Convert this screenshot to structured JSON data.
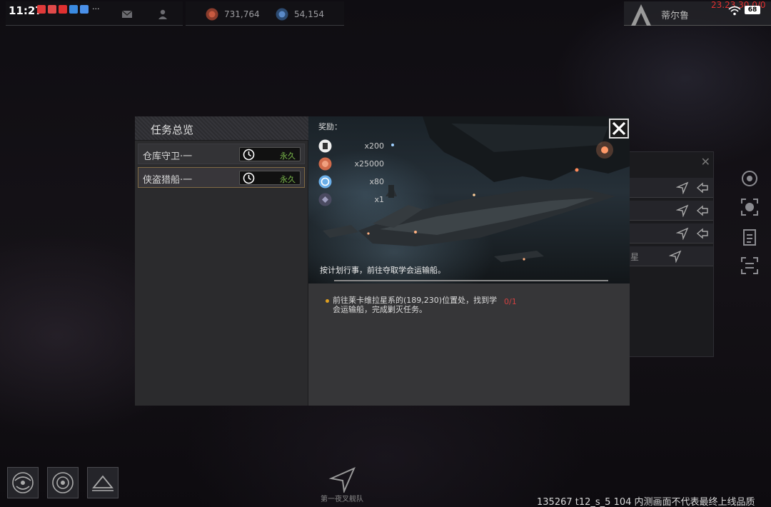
{
  "status_bar": {
    "time": "11:27",
    "notification_more": "···",
    "red_time": "23.23.30.0/0",
    "battery": "68"
  },
  "resources": {
    "credits": "731,764",
    "secondary": "54,154"
  },
  "player": {
    "name": "蒂尔鲁"
  },
  "background_panel": {
    "row4_text": "星"
  },
  "quest_panel": {
    "title": "任务总览",
    "quests": [
      {
        "name": "仓库守卫·一",
        "duration": "永久"
      },
      {
        "name": "侠盗猎船·一",
        "duration": "永久"
      }
    ],
    "selected_index": 1
  },
  "quest_detail": {
    "rewards_label": "奖励：",
    "rewards": [
      {
        "icon": "blueprint-icon",
        "qty": "x200"
      },
      {
        "icon": "credits-icon",
        "qty": "x25000"
      },
      {
        "icon": "crystal-icon",
        "qty": "x80"
      },
      {
        "icon": "module-icon",
        "qty": "x1"
      }
    ],
    "description": "按计划行事，前往夺取学会运输船。",
    "objective": {
      "text": "前往莱卡维拉星系的(189,230)位置处，找到学会运输船，完成剿灭任务。",
      "progress": "0/1"
    }
  },
  "bottom": {
    "fleet_label": "第一夜叉舰队",
    "watermark": "135267 t12_s_5 104  内测画面不代表最终上线品质"
  },
  "colors": {
    "accent_green": "#7ab84a",
    "progress_red": "#d04040",
    "selected_border": "#806a45",
    "bullet": "#e0a020"
  }
}
